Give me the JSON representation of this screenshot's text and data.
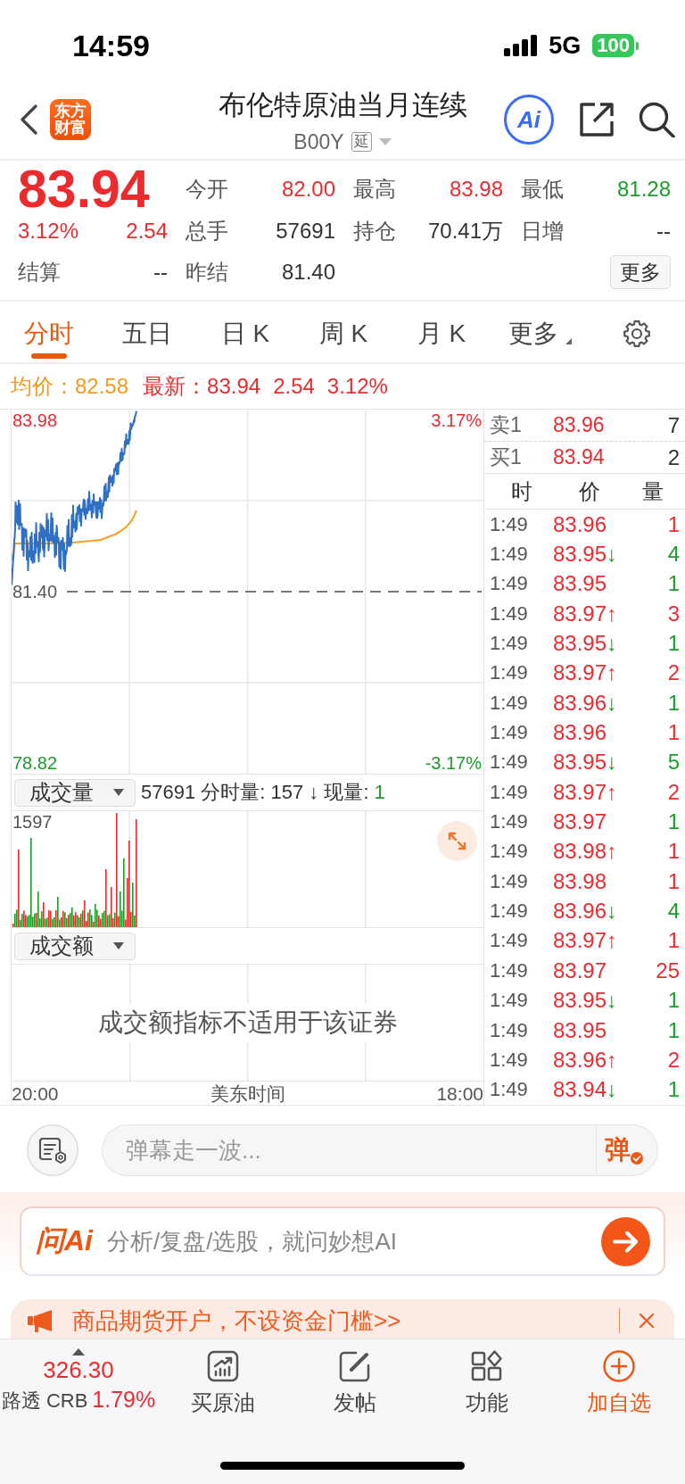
{
  "status_bar": {
    "time": "14:59",
    "network": "5G",
    "battery": "100"
  },
  "header": {
    "logo": [
      "东方",
      "财富"
    ],
    "title": "布伦特原油当月连续",
    "code": "B00Y",
    "delay_badge": "延",
    "ai_button": "Ai"
  },
  "quote": {
    "price": "83.94",
    "change_pct": "3.12%",
    "change": "2.54",
    "rising": true,
    "settle": {
      "label": "结算",
      "value": "--"
    },
    "stats": [
      {
        "label": "今开",
        "value": "82.00",
        "color": "#ec2b2f"
      },
      {
        "label": "最高",
        "value": "83.98",
        "color": "#ec2b2f"
      },
      {
        "label": "最低",
        "value": "81.28",
        "color": "#1a9e2a"
      },
      {
        "label": "总手",
        "value": "57691",
        "color": "#333333"
      },
      {
        "label": "持仓",
        "value": "70.41万",
        "color": "#333333"
      },
      {
        "label": "日增",
        "value": "--",
        "color": "#333333"
      },
      {
        "label": "昨结",
        "value": "81.40",
        "color": "#333333"
      }
    ],
    "more_button": "更多"
  },
  "chart_tabs": [
    {
      "label": "分时",
      "selected": true,
      "kind": "tab"
    },
    {
      "label": "五日",
      "selected": false,
      "kind": "tab"
    },
    {
      "label": "日 K",
      "selected": false,
      "kind": "tab"
    },
    {
      "label": "周 K",
      "selected": false,
      "kind": "tab"
    },
    {
      "label": "月 K",
      "selected": false,
      "kind": "tab"
    },
    {
      "label": "更多",
      "selected": false,
      "kind": "dropdown"
    }
  ],
  "price_summary": {
    "avg_label": "均价：",
    "avg_value": "82.58",
    "latest_label": "最新：",
    "latest_value": "83.94",
    "change": "2.54",
    "change_pct": "3.12%"
  },
  "price_chart": {
    "high": "83.98",
    "high_pct": "3.17%",
    "reference": "81.40",
    "low": "78.82",
    "low_pct": "-3.17%"
  },
  "volume_panel": {
    "selector": "成交量",
    "summary": "57691 分时量: 157 ↓ 现量:",
    "current": {
      "value": "1",
      "color": "#1a9e2a"
    },
    "max": "1597"
  },
  "amount_panel": {
    "selector": "成交额",
    "message": "成交额指标不适用于该证券"
  },
  "time_axis": {
    "start": "20:00",
    "zone": "美东时间",
    "end": "18:00"
  },
  "order_book": [
    {
      "label": "卖1",
      "price": "83.96",
      "volume": "7"
    },
    {
      "label": "买1",
      "price": "83.94",
      "volume": "2"
    }
  ],
  "trades": {
    "columns": [
      "时",
      "价",
      "量"
    ],
    "rows": [
      {
        "time": "1:49",
        "price": "83.96",
        "color": "#ec2b2f",
        "volume": "1"
      },
      {
        "time": "1:49",
        "price": "83.95",
        "arrow": "↓",
        "color": "#1a9e2a",
        "volume": "4"
      },
      {
        "time": "1:49",
        "price": "83.95",
        "color": "#1a9e2a",
        "volume": "1"
      },
      {
        "time": "1:49",
        "price": "83.97",
        "arrow": "↑",
        "color": "#ec2b2f",
        "volume": "3"
      },
      {
        "time": "1:49",
        "price": "83.95",
        "arrow": "↓",
        "color": "#1a9e2a",
        "volume": "1"
      },
      {
        "time": "1:49",
        "price": "83.97",
        "arrow": "↑",
        "color": "#ec2b2f",
        "volume": "2"
      },
      {
        "time": "1:49",
        "price": "83.96",
        "arrow": "↓",
        "color": "#1a9e2a",
        "volume": "1"
      },
      {
        "time": "1:49",
        "price": "83.96",
        "color": "#ec2b2f",
        "volume": "1"
      },
      {
        "time": "1:49",
        "price": "83.95",
        "arrow": "↓",
        "color": "#1a9e2a",
        "volume": "5"
      },
      {
        "time": "1:49",
        "price": "83.97",
        "arrow": "↑",
        "color": "#ec2b2f",
        "volume": "2"
      },
      {
        "time": "1:49",
        "price": "83.97",
        "color": "#1a9e2a",
        "volume": "1"
      },
      {
        "time": "1:49",
        "price": "83.98",
        "arrow": "↑",
        "color": "#ec2b2f",
        "volume": "1"
      },
      {
        "time": "1:49",
        "price": "83.98",
        "color": "#ec2b2f",
        "volume": "1"
      },
      {
        "time": "1:49",
        "price": "83.96",
        "arrow": "↓",
        "color": "#1a9e2a",
        "volume": "4"
      },
      {
        "time": "1:49",
        "price": "83.97",
        "arrow": "↑",
        "color": "#ec2b2f",
        "volume": "1"
      },
      {
        "time": "1:49",
        "price": "83.97",
        "color": "#ec2b2f",
        "volume": "25"
      },
      {
        "time": "1:49",
        "price": "83.95",
        "arrow": "↓",
        "color": "#1a9e2a",
        "volume": "1"
      },
      {
        "time": "1:49",
        "price": "83.95",
        "color": "#1a9e2a",
        "volume": "1"
      },
      {
        "time": "1:49",
        "price": "83.96",
        "arrow": "↑",
        "color": "#ec2b2f",
        "volume": "2"
      },
      {
        "time": "1:49",
        "price": "83.94",
        "arrow": "↓",
        "color": "#1a9e2a",
        "volume": "1"
      }
    ]
  },
  "danmu": {
    "placeholder": "弹幕走一波...",
    "send": "弹"
  },
  "ask_ai": {
    "logo": "问Ai",
    "placeholder": "分析/复盘/选股，就问妙想AI"
  },
  "banner": {
    "text": "商品期货开户，不设资金门槛>>"
  },
  "bottom_nav": [
    {
      "kind": "quote",
      "value": "326.30",
      "label": "路透 CRB",
      "change": "1.79%",
      "rising": true
    },
    {
      "kind": "action",
      "label": "买原油",
      "primary": false
    },
    {
      "kind": "action",
      "label": "发帖",
      "primary": false
    },
    {
      "kind": "action",
      "label": "功能",
      "primary": false
    },
    {
      "kind": "action",
      "label": "加自选",
      "primary": true
    }
  ]
}
